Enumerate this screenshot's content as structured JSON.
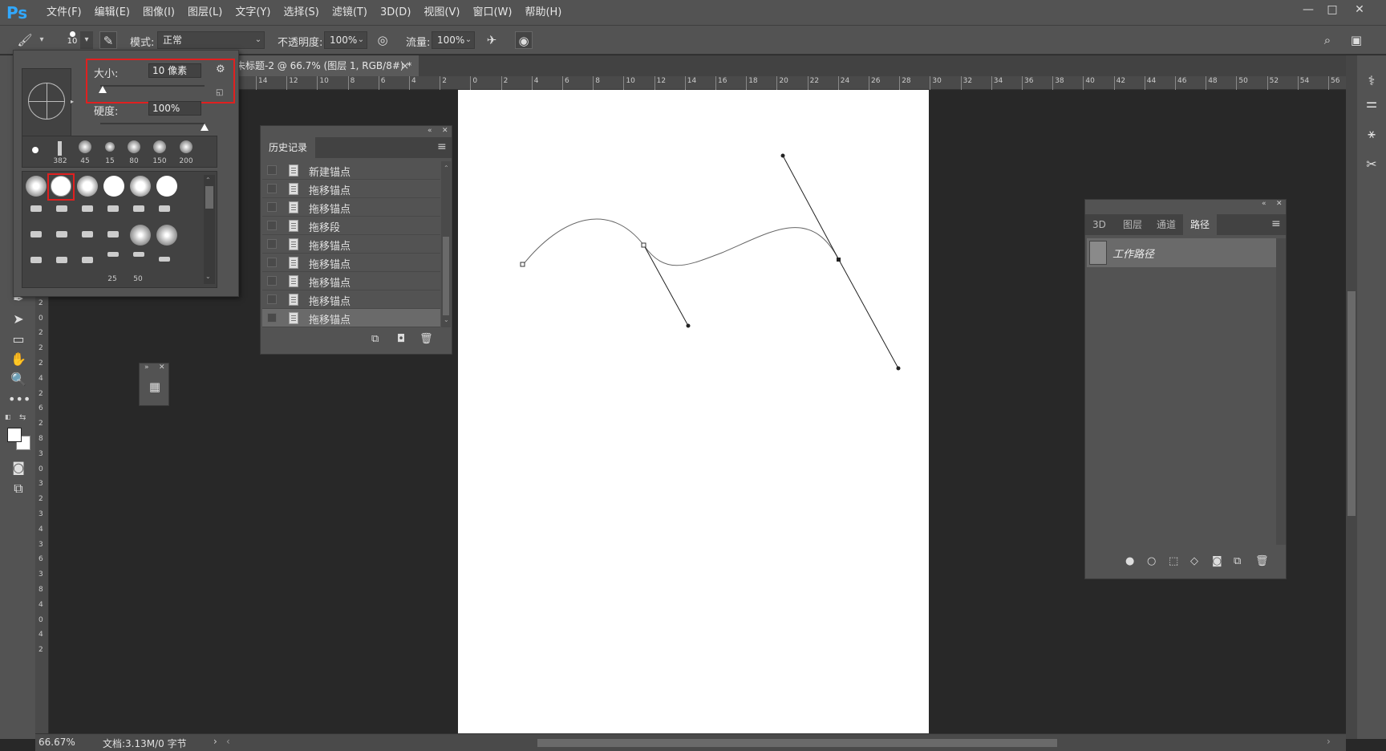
{
  "app": {
    "logo": "Ps"
  },
  "menu": [
    "文件(F)",
    "编辑(E)",
    "图像(I)",
    "图层(L)",
    "文字(Y)",
    "选择(S)",
    "滤镜(T)",
    "3D(D)",
    "视图(V)",
    "窗口(W)",
    "帮助(H)"
  ],
  "window_controls": {
    "minimize": "—",
    "maximize": "□",
    "close": "✕"
  },
  "options": {
    "brush_size_value": "10",
    "mode_label": "模式:",
    "mode_value": "正常",
    "opacity_label": "不透明度:",
    "opacity_value": "100%",
    "flow_label": "流量:",
    "flow_value": "100%"
  },
  "document": {
    "tab_title": "未标题-2 @ 66.7% (图层 1, RGB/8#) *",
    "close": "×"
  },
  "ruler_h_ticks": [
    "14",
    "12",
    "10",
    "8",
    "6",
    "4",
    "2",
    "0",
    "2",
    "4",
    "6",
    "8",
    "10",
    "12",
    "14",
    "16",
    "18",
    "20",
    "22",
    "24",
    "26",
    "28",
    "30",
    "32",
    "34",
    "36",
    "38",
    "40",
    "42",
    "44",
    "46",
    "48",
    "50",
    "52",
    "54",
    "56"
  ],
  "ruler_v_ticks": [
    "1",
    "4",
    "1",
    "6",
    "1",
    "8",
    "2",
    "0",
    "2",
    "2",
    "2",
    "4",
    "2",
    "6",
    "2",
    "8",
    "3",
    "0",
    "3",
    "2",
    "3",
    "4",
    "3",
    "6",
    "3",
    "8",
    "4",
    "0",
    "4",
    "2"
  ],
  "brush_popup": {
    "size_label": "大小:",
    "size_value": "10 像素",
    "hardness_label": "硬度:",
    "hardness_value": "100%",
    "size_fraction": 0.02,
    "hardness_fraction": 1.0,
    "preset_labels": [
      "382",
      "45",
      "15",
      "80",
      "150",
      "200"
    ],
    "bottom_labels": [
      "25",
      "50"
    ]
  },
  "history": {
    "title": "历史记录",
    "items": [
      "新建锚点",
      "拖移锚点",
      "拖移锚点",
      "拖移段",
      "拖移锚点",
      "拖移锚点",
      "拖移锚点",
      "拖移锚点",
      "拖移锚点"
    ],
    "selected_index": 8
  },
  "paths_panel": {
    "tabs": [
      "3D",
      "图层",
      "通道",
      "路径"
    ],
    "active_tab": "路径",
    "items": [
      "工作路径"
    ]
  },
  "status": {
    "zoom": "66.67%",
    "doc_info": "文档:3.13M/0 字节"
  },
  "colors": {
    "ui_bg": "#535353",
    "canvas_bg": "#282828",
    "highlight_red": "#e02020",
    "ps_blue": "#31a8ff"
  }
}
